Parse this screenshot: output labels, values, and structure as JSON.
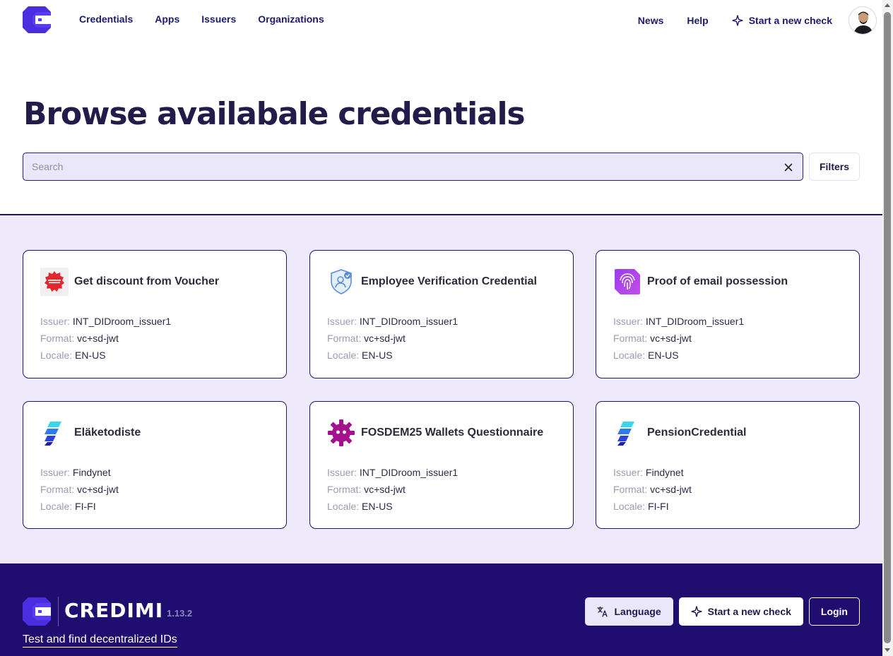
{
  "header": {
    "logo_icon": "credimi-logo-icon",
    "nav": [
      "Credentials",
      "Apps",
      "Issuers",
      "Organizations"
    ],
    "right_links": [
      "News",
      "Help"
    ],
    "start_check_label": "Start a new check",
    "start_check_icon": "sparkle-icon",
    "avatar_icon": "user-avatar"
  },
  "hero": {
    "title": "Browse availabale credentials",
    "search_placeholder": "Search",
    "search_value": "",
    "clear_icon": "close-icon",
    "filters_label": "Filters"
  },
  "labels": {
    "issuer": "Issuer: ",
    "format": "Format: ",
    "locale": "Locale: "
  },
  "cards": [
    {
      "title": "Get discount from Voucher",
      "issuer": "INT_DIDroom_issuer1",
      "format": "vc+sd-jwt",
      "locale": "EN-US",
      "icon": "discount-badge-icon"
    },
    {
      "title": "Employee Verification Credential",
      "issuer": "INT_DIDroom_issuer1",
      "format": "vc+sd-jwt",
      "locale": "EN-US",
      "icon": "shield-user-icon"
    },
    {
      "title": "Proof of email possession",
      "issuer": "INT_DIDroom_issuer1",
      "format": "vc+sd-jwt",
      "locale": "EN-US",
      "icon": "fingerprint-icon"
    },
    {
      "title": "Eläketodiste",
      "issuer": "Findynet",
      "format": "vc+sd-jwt",
      "locale": "FI-FI",
      "icon": "findynet-logo-icon"
    },
    {
      "title": "FOSDEM25 Wallets Questionnaire",
      "issuer": "INT_DIDroom_issuer1",
      "format": "vc+sd-jwt",
      "locale": "EN-US",
      "icon": "fosdem-gear-icon"
    },
    {
      "title": "PensionCredential",
      "issuer": "Findynet",
      "format": "vc+sd-jwt",
      "locale": "FI-FI",
      "icon": "findynet-logo-icon"
    }
  ],
  "footer": {
    "brand": "CREDIMI",
    "version": "1.13.2",
    "tagline": "Test and find decentralized IDs",
    "language_label": "Language",
    "start_check_label": "Start a new check",
    "login_label": "Login"
  },
  "colors": {
    "brand_dark": "#1f0e6f",
    "brand_accent": "#5b3bf5",
    "surface_lavender": "#eeeafc",
    "card_border": "#24106e"
  }
}
